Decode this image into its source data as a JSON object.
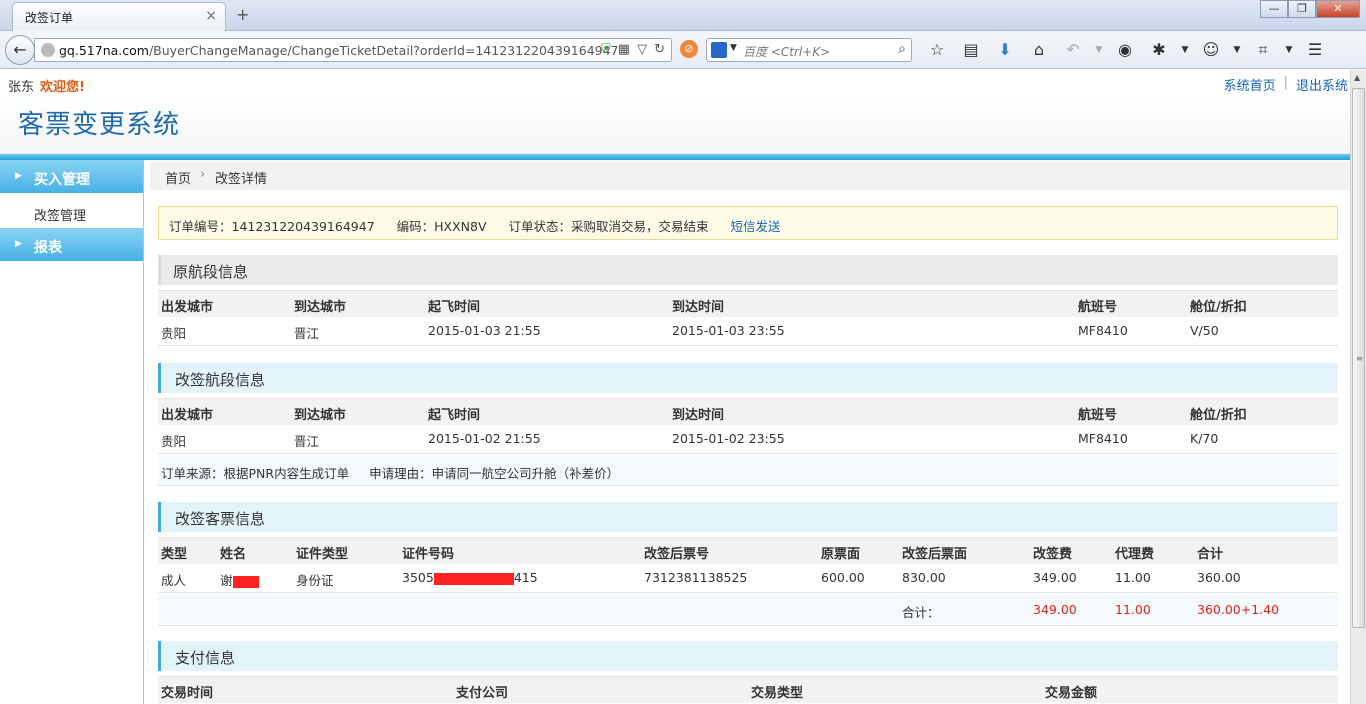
{
  "browser": {
    "tab_title": "改签订单",
    "tab_close": "×",
    "new_tab": "+",
    "url_domain": "gq.517na.com",
    "url_path": "/BuyerChangeManage/ChangeTicketDetail?orderId=141231220439164947",
    "search_placeholder": "百度 <Ctrl+K>",
    "win_minimize": "—",
    "win_maximize": "❐",
    "win_close": "✕"
  },
  "topbar": {
    "user": "张东",
    "welcome": "欢迎您!",
    "home_link": "系统首页",
    "logout_link": "退出系统"
  },
  "header": {
    "title": "客票变更系统"
  },
  "sidebar": {
    "section1": "买入管理",
    "sub_item": "改签管理",
    "section2": "报表"
  },
  "breadcrumb": {
    "home": "首页",
    "separator": "›",
    "current": "改签详情"
  },
  "order": {
    "number": "订单编号：141231220439164947",
    "code": "编码：HXXN8V",
    "status": "订单状态：采购取消交易，交易结束",
    "sms_link": "短信发送"
  },
  "original_segment": {
    "title": "原航段信息",
    "headers": [
      "出发城市",
      "到达城市",
      "起飞时间",
      "到达时间",
      "航班号",
      "舱位/折扣"
    ],
    "row": [
      "贵阳",
      "晋江",
      "2015-01-03 21:55",
      "2015-01-03 23:55",
      "MF8410",
      "V/50"
    ]
  },
  "changed_segment": {
    "title": "改签航段信息",
    "headers": [
      "出发城市",
      "到达城市",
      "起飞时间",
      "到达时间",
      "航班号",
      "舱位/折扣"
    ],
    "row": [
      "贵阳",
      "晋江",
      "2015-01-02 21:55",
      "2015-01-02 23:55",
      "MF8410",
      "K/70"
    ],
    "source": "订单来源：根据PNR内容生成订单",
    "reason": "申请理由：申请同一航空公司升舱（补差价）"
  },
  "passenger": {
    "title": "改签客票信息",
    "headers": [
      "类型",
      "姓名",
      "证件类型",
      "证件号码",
      "改签后票号",
      "原票面",
      "改签后票面",
      "改签费",
      "代理费",
      "合计"
    ],
    "row": {
      "type": "成人",
      "name_prefix": "谢",
      "id_type": "身份证",
      "id_prefix": "3505",
      "id_suffix": "415",
      "new_ticket": "7312381138525",
      "orig_fare": "600.00",
      "new_fare": "830.00",
      "change_fee": "349.00",
      "agent_fee": "11.00",
      "total": "360.00"
    },
    "sum_label": "合计：",
    "sum_change_fee": "349.00",
    "sum_agent_fee": "11.00",
    "sum_total": "360.00+1.40"
  },
  "payment": {
    "title": "支付信息",
    "headers": [
      "交易时间",
      "支付公司",
      "交易类型",
      "交易金额"
    ]
  },
  "colors": {
    "accent_blue": "#22a4dc",
    "title_blue": "#1f6aa8",
    "welcome_orange": "#e05b10",
    "total_red": "#d9251d"
  }
}
